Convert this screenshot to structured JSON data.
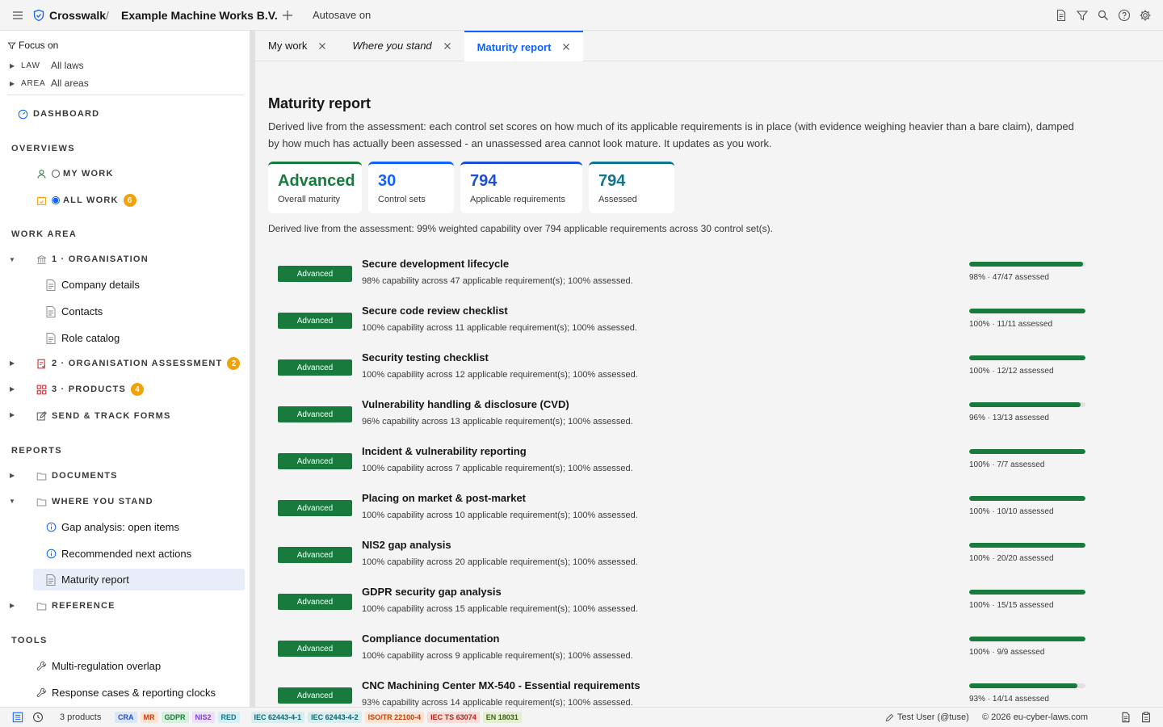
{
  "topbar": {
    "brand": "Crosswalk",
    "separator": "/",
    "org": "Example Machine Works B.V.",
    "autosave": "Autosave on"
  },
  "sidebar": {
    "focus_label": "Focus on",
    "filters": [
      {
        "key": "LAW",
        "value": "All laws"
      },
      {
        "key": "AREA",
        "value": "All areas"
      }
    ],
    "dashboard": "DASHBOARD",
    "overviews_title": "OVERVIEWS",
    "my_work": "MY WORK",
    "all_work": "ALL WORK",
    "all_work_badge": "6",
    "work_area_title": "WORK AREA",
    "organisation": "1 · ORGANISATION",
    "company_details": "Company details",
    "contacts": "Contacts",
    "role_catalog": "Role catalog",
    "org_assessment": "2 · ORGANISATION ASSESSMENT",
    "org_assessment_badge": "2",
    "products": "3 · PRODUCTS",
    "products_badge": "4",
    "send_track": "SEND & TRACK FORMS",
    "reports_title": "REPORTS",
    "documents": "DOCUMENTS",
    "where_you_stand": "WHERE YOU STAND",
    "gap_analysis": "Gap analysis: open items",
    "next_actions": "Recommended next actions",
    "maturity_report": "Maturity report",
    "reference": "REFERENCE",
    "tools_title": "TOOLS",
    "overlap": "Multi-regulation overlap",
    "response_cases": "Response cases & reporting clocks"
  },
  "tabs": [
    {
      "label": "My work"
    },
    {
      "label": "Where you stand"
    },
    {
      "label": "Maturity report"
    }
  ],
  "main": {
    "title": "Maturity report",
    "intro": "Derived live from the assessment: each control set scores on how much of its applicable requirements is in place (with evidence weighing heavier than a bare claim), damped by how much has actually been assessed - an unassessed area cannot look mature. It updates as you work.",
    "kpis": [
      {
        "value": "Advanced",
        "label": "Overall maturity",
        "color": "#197a3e"
      },
      {
        "value": "30",
        "label": "Control sets",
        "color": "#0f62fe"
      },
      {
        "value": "794",
        "label": "Applicable requirements",
        "color": "#1d4ed8"
      },
      {
        "value": "794",
        "label": "Assessed",
        "color": "#0e7490"
      }
    ],
    "summary": "Derived live from the assessment: 99% weighted capability over 794 applicable requirements across 30 control set(s).",
    "rows": [
      {
        "level": "Advanced",
        "name": "Secure development lifecycle",
        "desc": "98% capability across 47 applicable requirement(s); 100% assessed.",
        "progress": 98,
        "stat": "98% · 47/47 assessed"
      },
      {
        "level": "Advanced",
        "name": "Secure code review checklist",
        "desc": "100% capability across 11 applicable requirement(s); 100% assessed.",
        "progress": 100,
        "stat": "100% · 11/11 assessed"
      },
      {
        "level": "Advanced",
        "name": "Security testing checklist",
        "desc": "100% capability across 12 applicable requirement(s); 100% assessed.",
        "progress": 100,
        "stat": "100% · 12/12 assessed"
      },
      {
        "level": "Advanced",
        "name": "Vulnerability handling & disclosure (CVD)",
        "desc": "96% capability across 13 applicable requirement(s); 100% assessed.",
        "progress": 96,
        "stat": "96% · 13/13 assessed"
      },
      {
        "level": "Advanced",
        "name": "Incident & vulnerability reporting",
        "desc": "100% capability across 7 applicable requirement(s); 100% assessed.",
        "progress": 100,
        "stat": "100% · 7/7 assessed"
      },
      {
        "level": "Advanced",
        "name": "Placing on market & post-market",
        "desc": "100% capability across 10 applicable requirement(s); 100% assessed.",
        "progress": 100,
        "stat": "100% · 10/10 assessed"
      },
      {
        "level": "Advanced",
        "name": "NIS2 gap analysis",
        "desc": "100% capability across 20 applicable requirement(s); 100% assessed.",
        "progress": 100,
        "stat": "100% · 20/20 assessed"
      },
      {
        "level": "Advanced",
        "name": "GDPR security gap analysis",
        "desc": "100% capability across 15 applicable requirement(s); 100% assessed.",
        "progress": 100,
        "stat": "100% · 15/15 assessed"
      },
      {
        "level": "Advanced",
        "name": "Compliance documentation",
        "desc": "100% capability across 9 applicable requirement(s); 100% assessed.",
        "progress": 100,
        "stat": "100% · 9/9 assessed"
      },
      {
        "level": "Advanced",
        "name": "CNC Machining Center MX-540 - Essential requirements",
        "desc": "93% capability across 14 applicable requirement(s); 100% assessed.",
        "progress": 93,
        "stat": "93% · 14/14 assessed"
      }
    ]
  },
  "statusbar": {
    "products": "3 products",
    "chips": [
      {
        "label": "CRA",
        "bg": "#dbe6fb",
        "fg": "#1d4ed8"
      },
      {
        "label": "MR",
        "bg": "#fde4d2",
        "fg": "#c2410c"
      },
      {
        "label": "GDPR",
        "bg": "#d7f0dd",
        "fg": "#197a3e"
      },
      {
        "label": "NIS2",
        "bg": "#ece0fb",
        "fg": "#7e3fd0"
      },
      {
        "label": "RED",
        "bg": "#d6eef5",
        "fg": "#0e7490"
      },
      {
        "label": "IEC 62443-4-1",
        "bg": "#d6eef0",
        "fg": "#0e6570"
      },
      {
        "label": "IEC 62443-4-2",
        "bg": "#d6eef0",
        "fg": "#0e6570"
      },
      {
        "label": "ISO/TR 22100-4",
        "bg": "#fde4d2",
        "fg": "#c2410c"
      },
      {
        "label": "IEC TS 63074",
        "bg": "#fbdcd9",
        "fg": "#b42318"
      },
      {
        "label": "EN 18031",
        "bg": "#e4efd2",
        "fg": "#3f6212"
      }
    ],
    "user": "Test User (@tuse)",
    "copyright": "© 2026 eu-cyber-laws.com"
  }
}
